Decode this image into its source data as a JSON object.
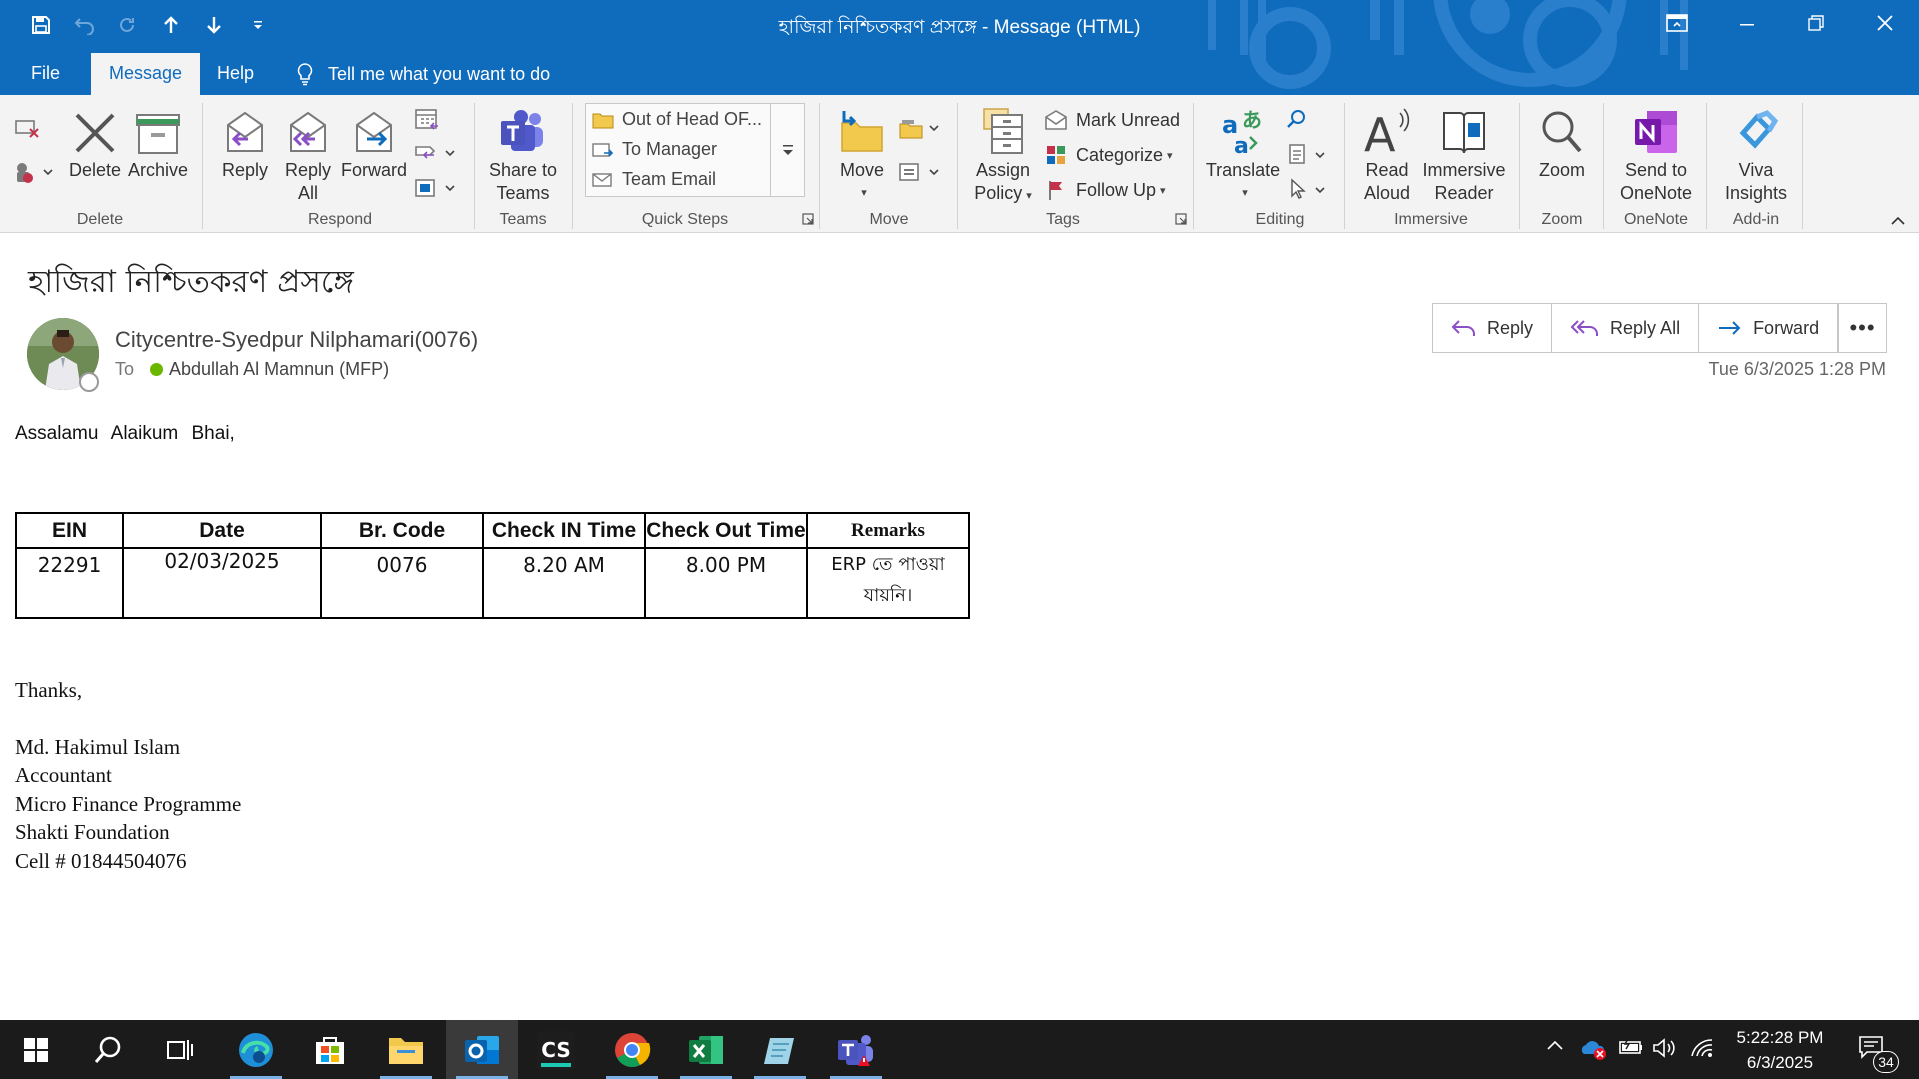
{
  "window": {
    "title": "হাজিরা নিশ্চিতকরণ প্রসঙ্গে  -  Message (HTML)"
  },
  "tabs": [
    {
      "label": "File"
    },
    {
      "label": "Message"
    },
    {
      "label": "Help"
    }
  ],
  "tell_me": "Tell me what you want to do",
  "ribbon": {
    "delete_group": {
      "label": "Delete",
      "delete": "Delete",
      "archive": "Archive"
    },
    "respond_group": {
      "label": "Respond",
      "reply": "Reply",
      "reply_all_1": "Reply",
      "reply_all_2": "All",
      "forward": "Forward"
    },
    "teams_group": {
      "label": "Teams",
      "share_1": "Share to",
      "share_2": "Teams"
    },
    "quick_steps_group": {
      "label": "Quick Steps",
      "items": [
        "Out of Head OF...",
        "To Manager",
        "Team Email"
      ]
    },
    "move_group": {
      "label": "Move",
      "move": "Move"
    },
    "tags_group": {
      "label": "Tags",
      "assign_1": "Assign",
      "assign_2": "Policy",
      "mark_unread": "Mark Unread",
      "categorize": "Categorize",
      "follow_up": "Follow Up"
    },
    "editing_group": {
      "label": "Editing",
      "translate": "Translate"
    },
    "immersive_group": {
      "label": "Immersive",
      "read_1": "Read",
      "read_2": "Aloud",
      "imm_1": "Immersive",
      "imm_2": "Reader"
    },
    "zoom_group": {
      "label": "Zoom",
      "zoom": "Zoom"
    },
    "onenote_group": {
      "label": "OneNote",
      "send_1": "Send to",
      "send_2": "OneNote"
    },
    "addin_group": {
      "label": "Add-in",
      "viva_1": "Viva",
      "viva_2": "Insights"
    }
  },
  "message": {
    "subject": "হাজিরা নিশ্চিতকরণ প্রসঙ্গে",
    "sender": "Citycentre-Syedpur Nilphamari(0076)",
    "to_label": "To",
    "recipient": "Abdullah Al Mamnun (MFP)",
    "timestamp": "Tue 6/3/2025 1:28 PM",
    "actions": {
      "reply": "Reply",
      "reply_all": "Reply All",
      "forward": "Forward",
      "more": "•••"
    },
    "greeting": "Assalamu Alaikum Bhai,",
    "table": {
      "headers": [
        "EIN",
        "Date",
        "Br. Code",
        "Check IN Time",
        "Check Out Time",
        "Remarks"
      ],
      "row": [
        "22291",
        "02/03/2025",
        "0076",
        "8.20 AM",
        "8.00 PM"
      ],
      "remark_1": "ERP তে পাওয়া",
      "remark_2": "যায়নি।"
    },
    "signature": {
      "thanks": "Thanks,",
      "name": "Md. Hakimul Islam",
      "title": "Accountant",
      "dept": "Micro Finance Programme",
      "org": "Shakti Foundation",
      "cell": "Cell # 01844504076"
    }
  },
  "taskbar": {
    "time": "5:22:28 PM",
    "date": "6/3/2025",
    "notifications": "34",
    "cs_label": "CS"
  },
  "colors": {
    "accent": "#0f6cbd",
    "taskbar": "#1b1b1b",
    "presence_available": "#6bb700"
  }
}
